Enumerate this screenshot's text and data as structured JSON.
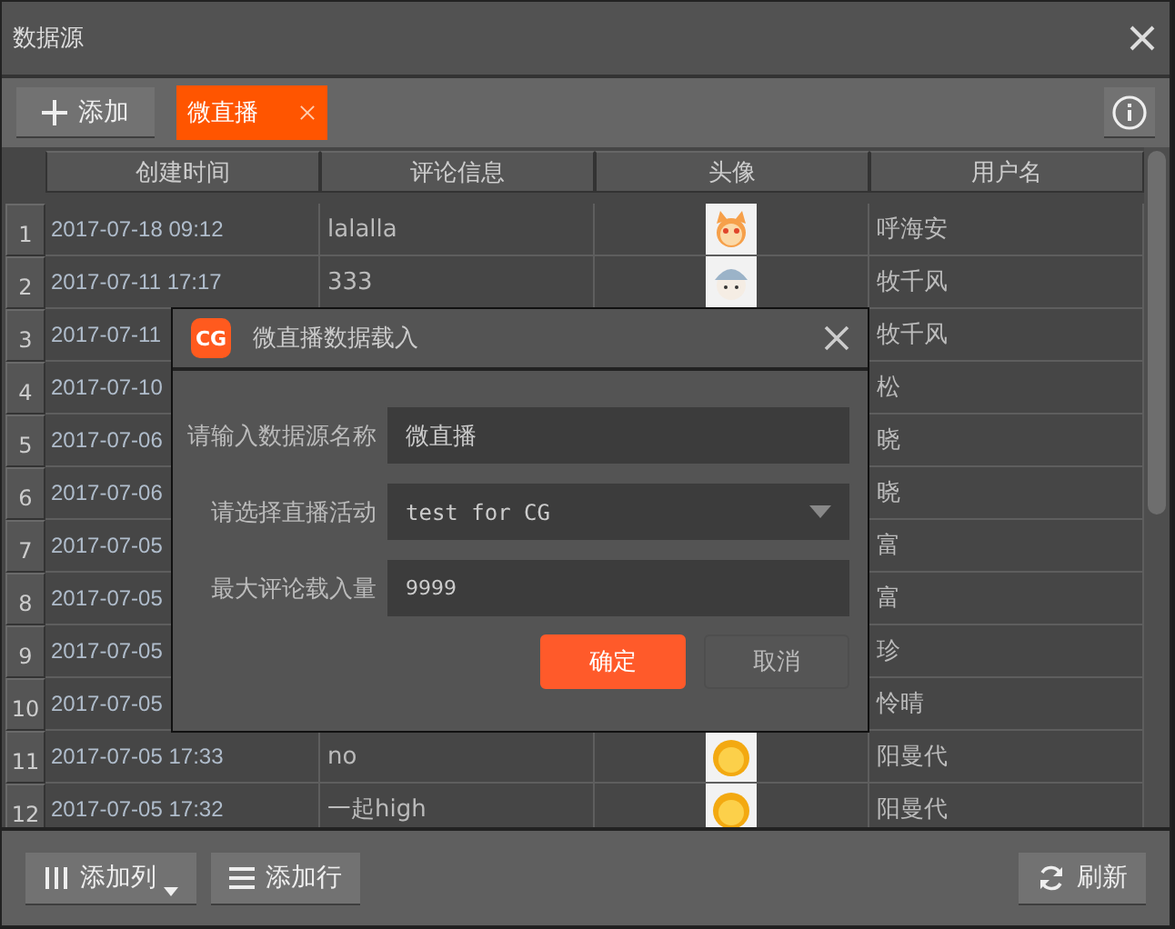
{
  "window": {
    "title": "数据源"
  },
  "toolbar": {
    "add_button": "添加",
    "tabs": [
      {
        "label": "微直播",
        "selected": true
      }
    ]
  },
  "table": {
    "columns": [
      "创建时间",
      "评论信息",
      "头像",
      "用户名"
    ],
    "rows": [
      {
        "index": "1",
        "created": "2017-07-18 09:12",
        "comment": "lalalla",
        "user": "呼海安"
      },
      {
        "index": "2",
        "created": "2017-07-11 17:17",
        "comment": "333",
        "user": "牧千风"
      },
      {
        "index": "3",
        "created": "2017-07-11",
        "user": "牧千风"
      },
      {
        "index": "4",
        "created": "2017-07-10",
        "user": "松"
      },
      {
        "index": "5",
        "created": "2017-07-06",
        "user": "晓"
      },
      {
        "index": "6",
        "created": "2017-07-06",
        "user": "晓"
      },
      {
        "index": "7",
        "created": "2017-07-05",
        "user": "富"
      },
      {
        "index": "8",
        "created": "2017-07-05",
        "user": "富"
      },
      {
        "index": "9",
        "created": "2017-07-05",
        "user": "珍"
      },
      {
        "index": "10",
        "created": "2017-07-05",
        "user": "怜晴"
      },
      {
        "index": "11",
        "created": "2017-07-05 17:33",
        "comment": "no",
        "user": "阳曼代"
      },
      {
        "index": "12",
        "created": "2017-07-05 17:32",
        "comment": "一起high",
        "user": "阳曼代"
      }
    ]
  },
  "dialog": {
    "logo": "CG",
    "title": "微直播数据载入",
    "fields": [
      {
        "kind": "text",
        "label": "请输入数据源名称",
        "value": "微直播"
      },
      {
        "kind": "select",
        "label": "请选择直播活动",
        "value": "test for CG"
      },
      {
        "kind": "text",
        "label": "最大评论载入量",
        "value": "9999"
      }
    ],
    "buttons": [
      {
        "label": "确定",
        "primary": true
      },
      {
        "label": "取消",
        "primary": false
      }
    ]
  },
  "footer": {
    "buttons": [
      {
        "label": "添加列",
        "dropdown": true
      },
      {
        "label": "添加行",
        "dropdown": false
      }
    ],
    "refresh_button": "刷新"
  }
}
